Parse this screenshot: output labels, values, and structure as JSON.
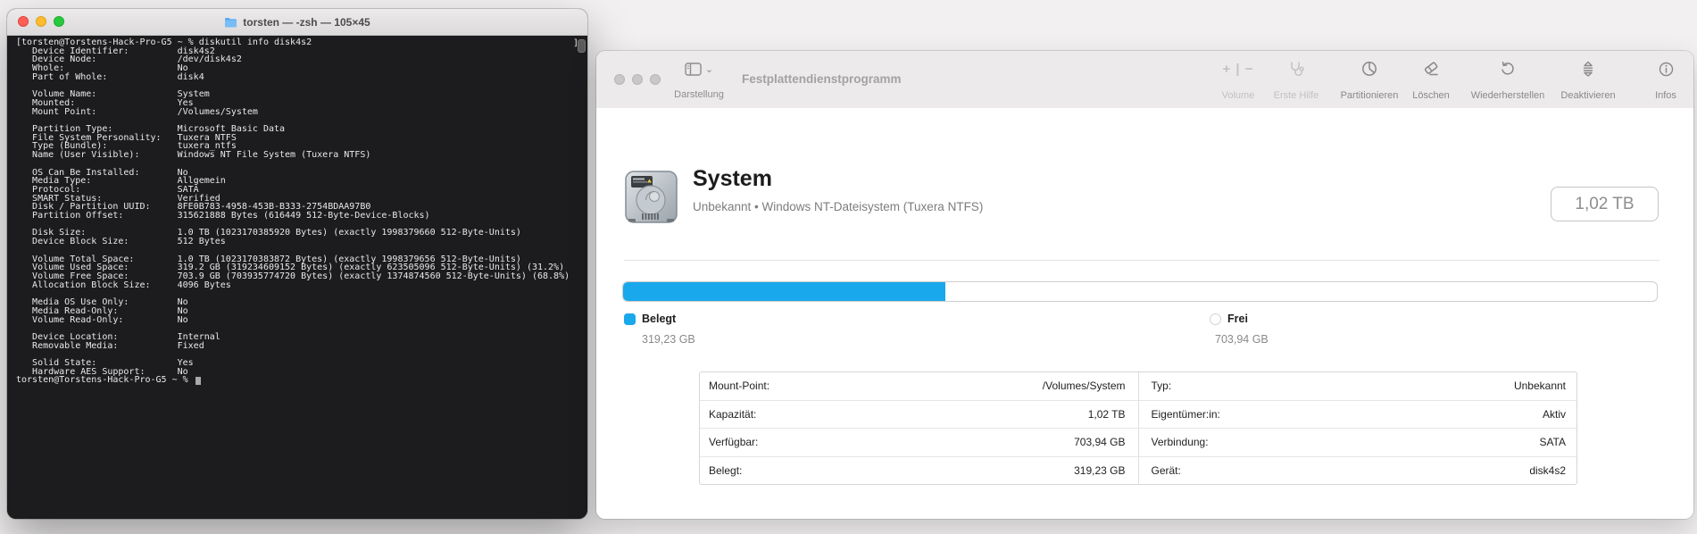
{
  "terminal": {
    "title": "torsten — -zsh — 105×45",
    "right_mark": "]",
    "lines": [
      "[torsten@Torstens-Hack-Pro-G5 ~ % diskutil info disk4s2",
      "   Device Identifier:         disk4s2",
      "   Device Node:               /dev/disk4s2",
      "   Whole:                     No",
      "   Part of Whole:             disk4",
      "",
      "   Volume Name:               System",
      "   Mounted:                   Yes",
      "   Mount Point:               /Volumes/System",
      "",
      "   Partition Type:            Microsoft Basic Data",
      "   File System Personality:   Tuxera NTFS",
      "   Type (Bundle):             tuxera_ntfs",
      "   Name (User Visible):       Windows NT File System (Tuxera NTFS)",
      "",
      "   OS Can Be Installed:       No",
      "   Media Type:                Allgemein",
      "   Protocol:                  SATA",
      "   SMART Status:              Verified",
      "   Disk / Partition UUID:     8FE0B783-4958-453B-B333-2754BDAA97B0",
      "   Partition Offset:          315621888 Bytes (616449 512-Byte-Device-Blocks)",
      "",
      "   Disk Size:                 1.0 TB (1023170385920 Bytes) (exactly 1998379660 512-Byte-Units)",
      "   Device Block Size:         512 Bytes",
      "",
      "   Volume Total Space:        1.0 TB (1023170383872 Bytes) (exactly 1998379656 512-Byte-Units)",
      "   Volume Used Space:         319.2 GB (319234609152 Bytes) (exactly 623505096 512-Byte-Units) (31.2%)",
      "   Volume Free Space:         703.9 GB (703935774720 Bytes) (exactly 1374874560 512-Byte-Units) (68.8%)",
      "   Allocation Block Size:     4096 Bytes",
      "",
      "   Media OS Use Only:         No",
      "   Media Read-Only:           No",
      "   Volume Read-Only:          No",
      "",
      "   Device Location:           Internal",
      "   Removable Media:           Fixed",
      "",
      "   Solid State:               Yes",
      "   Hardware AES Support:      No",
      ""
    ],
    "prompt": "torsten@Torstens-Hack-Pro-G5 ~ % "
  },
  "disk_utility": {
    "window_title": "Festplattendienstprogramm",
    "view_button": {
      "label": "Darstellung"
    },
    "toolbar": [
      {
        "label": "Volume",
        "icon": "plus-minus-volume-icon",
        "enabled": false
      },
      {
        "label": "Erste Hilfe",
        "icon": "stethoscope-icon",
        "enabled": false
      },
      {
        "label": "Partitionieren",
        "icon": "pie-chart-icon",
        "enabled": true
      },
      {
        "label": "Löschen",
        "icon": "eraser-icon",
        "enabled": true
      },
      {
        "label": "Wiederherstellen",
        "icon": "restore-arrow-icon",
        "enabled": true
      },
      {
        "label": "Deaktivieren",
        "icon": "unmount-stack-icon",
        "enabled": true
      },
      {
        "label": "Infos",
        "icon": "info-circle-icon",
        "enabled": true
      }
    ],
    "header": {
      "name": "System",
      "subtitle": "Unbekannt • Windows NT-Dateisystem (Tuxera NTFS)",
      "capacity": "1,02 TB"
    },
    "usage": {
      "used_label": "Belegt",
      "used_value": "319,23 GB",
      "free_label": "Frei",
      "free_value": "703,94 GB",
      "used_percent": 31.2,
      "used_color": "#1aa8ec"
    },
    "table": {
      "left": [
        {
          "label": "Mount-Point:",
          "value": "/Volumes/System"
        },
        {
          "label": "Kapazität:",
          "value": "1,02 TB"
        },
        {
          "label": "Verfügbar:",
          "value": "703,94 GB"
        },
        {
          "label": "Belegt:",
          "value": "319,23 GB"
        }
      ],
      "right": [
        {
          "label": "Typ:",
          "value": "Unbekannt"
        },
        {
          "label": "Eigentümer:in:",
          "value": "Aktiv"
        },
        {
          "label": "Verbindung:",
          "value": "SATA"
        },
        {
          "label": "Gerät:",
          "value": "disk4s2"
        }
      ]
    }
  }
}
